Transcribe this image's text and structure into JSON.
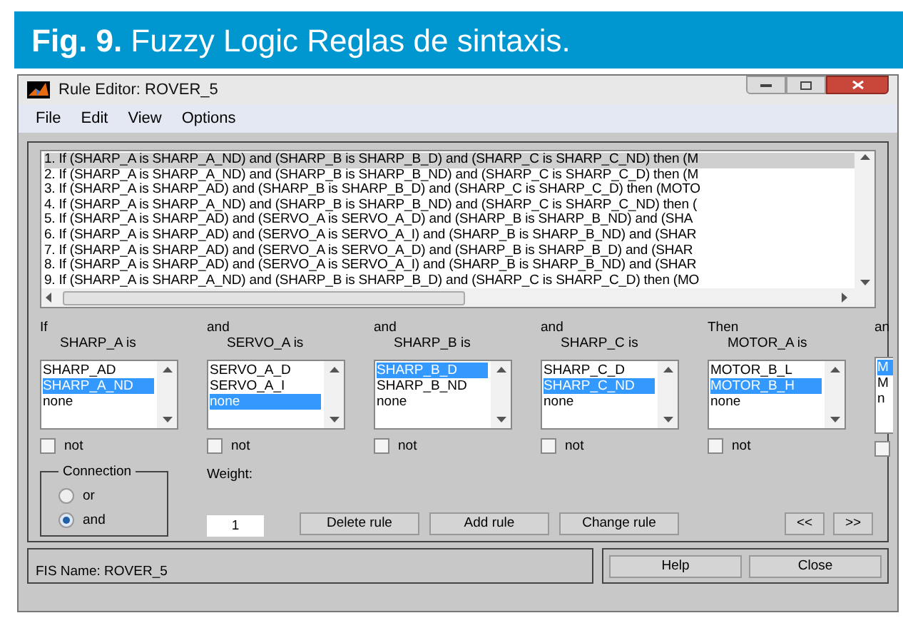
{
  "caption": {
    "label": "Fig. 9.",
    "text": "Fuzzy Logic Reglas de sintaxis."
  },
  "window": {
    "title": "Rule Editor: ROVER_5"
  },
  "menu": [
    "File",
    "Edit",
    "View",
    "Options"
  ],
  "rules": [
    {
      "text": "1. If (SHARP_A is SHARP_A_ND) and (SHARP_B is SHARP_B_D) and (SHARP_C is SHARP_C_ND) then (M",
      "selected": true
    },
    {
      "text": "2. If (SHARP_A is SHARP_A_ND) and (SHARP_B is SHARP_B_ND) and (SHARP_C is SHARP_C_D) then (M",
      "selected": false
    },
    {
      "text": "3. If (SHARP_A is SHARP_AD) and (SHARP_B is SHARP_B_D) and (SHARP_C is SHARP_C_D) then (MOTO",
      "selected": false
    },
    {
      "text": "4. If (SHARP_A is SHARP_A_ND) and (SHARP_B is SHARP_B_ND) and (SHARP_C is SHARP_C_ND) then (",
      "selected": false
    },
    {
      "text": "5. If (SHARP_A is SHARP_AD) and (SERVO_A is SERVO_A_D) and (SHARP_B is SHARP_B_ND) and (SHA",
      "selected": false
    },
    {
      "text": "6. If (SHARP_A is SHARP_AD) and (SERVO_A is SERVO_A_I) and (SHARP_B is SHARP_B_ND) and (SHAR",
      "selected": false
    },
    {
      "text": "7. If (SHARP_A is SHARP_AD) and (SERVO_A is SERVO_A_D) and (SHARP_B is SHARP_B_D) and (SHAR",
      "selected": false
    },
    {
      "text": "8. If (SHARP_A is SHARP_AD) and (SERVO_A is SERVO_A_I) and (SHARP_B is SHARP_B_ND) and (SHAR",
      "selected": false
    },
    {
      "text": "9. If (SHARP_A is SHARP_A_ND) and (SHARP_B is SHARP_B_D) and (SHARP_C is SHARP_C_D) then (MO",
      "selected": false
    }
  ],
  "columns": [
    {
      "connective": "If",
      "variable": "SHARP_A is",
      "not": false,
      "not_text": "not",
      "items": [
        {
          "label": "SHARP_AD",
          "selected": false
        },
        {
          "label": "SHARP_A_ND",
          "selected": true
        },
        {
          "label": "none",
          "selected": false
        }
      ]
    },
    {
      "connective": "and",
      "variable": "SERVO_A is",
      "not": false,
      "not_text": "not",
      "items": [
        {
          "label": "SERVO_A_D",
          "selected": false
        },
        {
          "label": "SERVO_A_I",
          "selected": false
        },
        {
          "label": "none",
          "selected": true
        }
      ]
    },
    {
      "connective": "and",
      "variable": "SHARP_B is",
      "not": false,
      "not_text": "not",
      "items": [
        {
          "label": "SHARP_B_D",
          "selected": true
        },
        {
          "label": "SHARP_B_ND",
          "selected": false
        },
        {
          "label": "none",
          "selected": false
        }
      ]
    },
    {
      "connective": "and",
      "variable": "SHARP_C is",
      "not": false,
      "not_text": "not",
      "items": [
        {
          "label": "SHARP_C_D",
          "selected": false
        },
        {
          "label": "SHARP_C_ND",
          "selected": true
        },
        {
          "label": "none",
          "selected": false
        }
      ]
    },
    {
      "connective": "Then",
      "variable": "MOTOR_A is",
      "not": false,
      "not_text": "not",
      "items": [
        {
          "label": "MOTOR_B_L",
          "selected": false
        },
        {
          "label": "MOTOR_B_H",
          "selected": true
        },
        {
          "label": "none",
          "selected": false
        }
      ]
    },
    {
      "connective": "an",
      "not": false,
      "items": [
        {
          "label": "M",
          "selected": true
        },
        {
          "label": "M",
          "selected": false
        },
        {
          "label": "n",
          "selected": false
        }
      ]
    }
  ],
  "connection": {
    "title": "Connection",
    "options": [
      {
        "label": "or",
        "selected": false
      },
      {
        "label": "and",
        "selected": true
      }
    ]
  },
  "weight": {
    "label": "Weight:",
    "value": "1"
  },
  "buttons": [
    "Delete rule",
    "Add rule",
    "Change rule",
    "<<",
    ">>"
  ],
  "status": "FIS Name: ROVER_5",
  "footer_buttons": [
    "Help",
    "Close"
  ]
}
